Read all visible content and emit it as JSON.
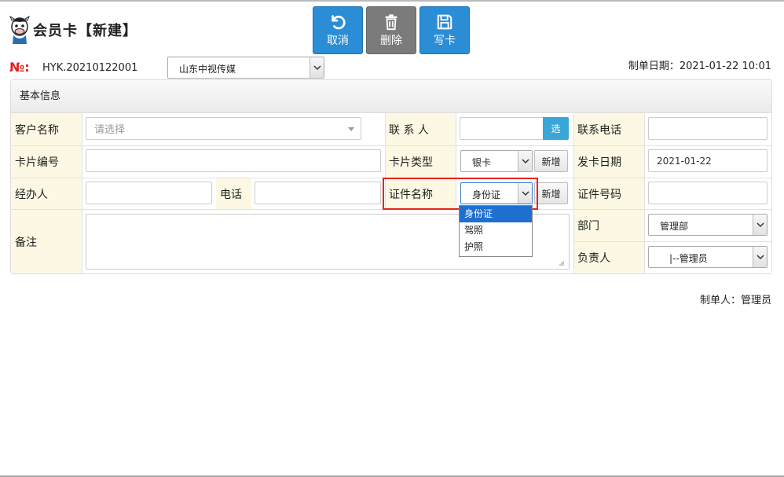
{
  "header": {
    "title": "会员卡【新建】"
  },
  "toolbar": {
    "cancel_label": "取消",
    "delete_label": "删除",
    "write_label": "写卡"
  },
  "order": {
    "no_label": "№:",
    "no_value": "HYK.20210122001",
    "company": "山东中视传媒",
    "date_label": "制单日期：",
    "date_value": "2021-01-22 10:01"
  },
  "panel": {
    "title": "基本信息"
  },
  "form": {
    "customer_label": "客户名称",
    "customer_placeholder": "请选择",
    "contact_label": "联 系 人",
    "contact_value": "",
    "pick_label": "选",
    "contact_phone_label": "联系电话",
    "contact_phone_value": "",
    "card_no_label": "卡片编号",
    "card_no_value": "",
    "card_type_label": "卡片类型",
    "card_type_value": "银卡",
    "new_label": "新增",
    "issue_date_label": "发卡日期",
    "issue_date_value": "2021-01-22",
    "handler_label": "经办人",
    "handler_value": "",
    "phone_label": "电话",
    "phone_value": "",
    "id_type_label": "证件名称",
    "id_type_value": "身份证",
    "id_no_label": "证件号码",
    "id_no_value": "",
    "remark_label": "备注",
    "remark_value": "",
    "dept_label": "部门",
    "dept_value": "管理部",
    "manager_label": "负责人",
    "manager_value": "|--管理员"
  },
  "id_type_options": [
    "身份证",
    "驾照",
    "护照"
  ],
  "footer": {
    "maker_label": "制单人：",
    "maker_value": "管理员"
  },
  "colors": {
    "accent": "#2a8dd6",
    "label_bg": "#fcf8e3",
    "highlight": "#e8231e",
    "no_label": "#e02020"
  }
}
